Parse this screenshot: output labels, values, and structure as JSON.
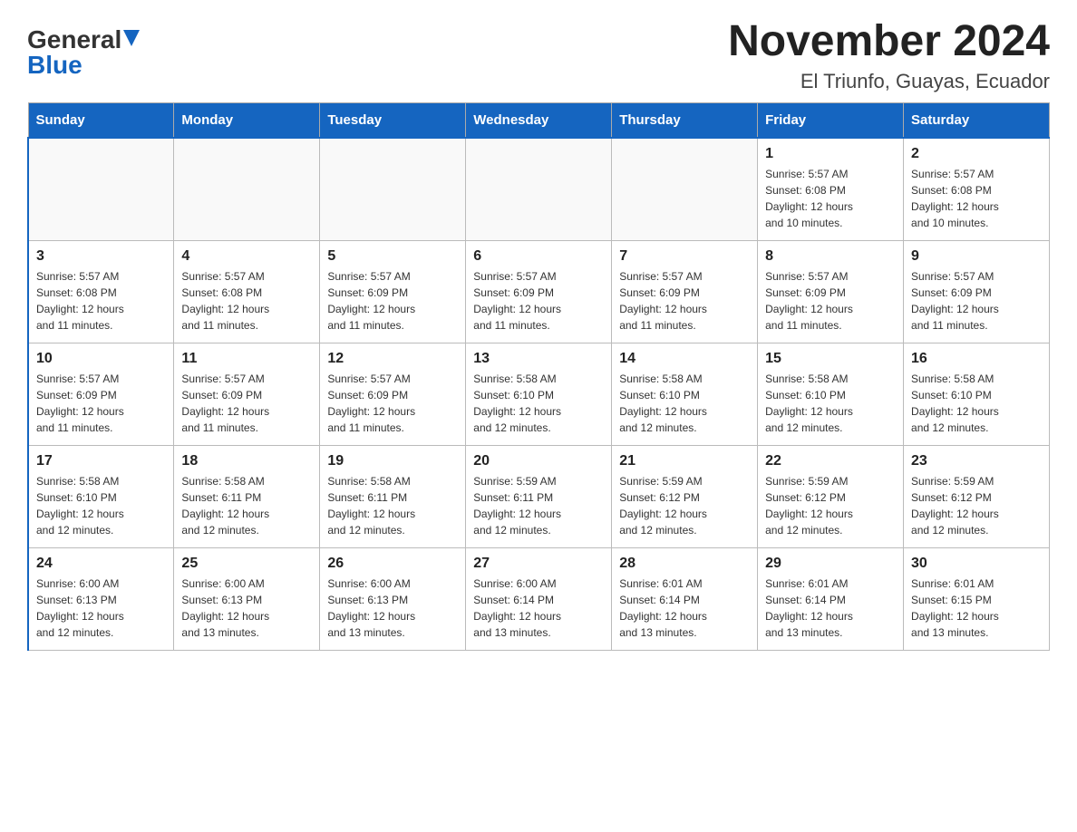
{
  "logo": {
    "general": "General",
    "blue": "Blue",
    "triangle": "▲"
  },
  "header": {
    "month_year": "November 2024",
    "location": "El Triunfo, Guayas, Ecuador"
  },
  "weekdays": [
    "Sunday",
    "Monday",
    "Tuesday",
    "Wednesday",
    "Thursday",
    "Friday",
    "Saturday"
  ],
  "weeks": [
    [
      {
        "day": "",
        "info": ""
      },
      {
        "day": "",
        "info": ""
      },
      {
        "day": "",
        "info": ""
      },
      {
        "day": "",
        "info": ""
      },
      {
        "day": "",
        "info": ""
      },
      {
        "day": "1",
        "info": "Sunrise: 5:57 AM\nSunset: 6:08 PM\nDaylight: 12 hours\nand 10 minutes."
      },
      {
        "day": "2",
        "info": "Sunrise: 5:57 AM\nSunset: 6:08 PM\nDaylight: 12 hours\nand 10 minutes."
      }
    ],
    [
      {
        "day": "3",
        "info": "Sunrise: 5:57 AM\nSunset: 6:08 PM\nDaylight: 12 hours\nand 11 minutes."
      },
      {
        "day": "4",
        "info": "Sunrise: 5:57 AM\nSunset: 6:08 PM\nDaylight: 12 hours\nand 11 minutes."
      },
      {
        "day": "5",
        "info": "Sunrise: 5:57 AM\nSunset: 6:09 PM\nDaylight: 12 hours\nand 11 minutes."
      },
      {
        "day": "6",
        "info": "Sunrise: 5:57 AM\nSunset: 6:09 PM\nDaylight: 12 hours\nand 11 minutes."
      },
      {
        "day": "7",
        "info": "Sunrise: 5:57 AM\nSunset: 6:09 PM\nDaylight: 12 hours\nand 11 minutes."
      },
      {
        "day": "8",
        "info": "Sunrise: 5:57 AM\nSunset: 6:09 PM\nDaylight: 12 hours\nand 11 minutes."
      },
      {
        "day": "9",
        "info": "Sunrise: 5:57 AM\nSunset: 6:09 PM\nDaylight: 12 hours\nand 11 minutes."
      }
    ],
    [
      {
        "day": "10",
        "info": "Sunrise: 5:57 AM\nSunset: 6:09 PM\nDaylight: 12 hours\nand 11 minutes."
      },
      {
        "day": "11",
        "info": "Sunrise: 5:57 AM\nSunset: 6:09 PM\nDaylight: 12 hours\nand 11 minutes."
      },
      {
        "day": "12",
        "info": "Sunrise: 5:57 AM\nSunset: 6:09 PM\nDaylight: 12 hours\nand 11 minutes."
      },
      {
        "day": "13",
        "info": "Sunrise: 5:58 AM\nSunset: 6:10 PM\nDaylight: 12 hours\nand 12 minutes."
      },
      {
        "day": "14",
        "info": "Sunrise: 5:58 AM\nSunset: 6:10 PM\nDaylight: 12 hours\nand 12 minutes."
      },
      {
        "day": "15",
        "info": "Sunrise: 5:58 AM\nSunset: 6:10 PM\nDaylight: 12 hours\nand 12 minutes."
      },
      {
        "day": "16",
        "info": "Sunrise: 5:58 AM\nSunset: 6:10 PM\nDaylight: 12 hours\nand 12 minutes."
      }
    ],
    [
      {
        "day": "17",
        "info": "Sunrise: 5:58 AM\nSunset: 6:10 PM\nDaylight: 12 hours\nand 12 minutes."
      },
      {
        "day": "18",
        "info": "Sunrise: 5:58 AM\nSunset: 6:11 PM\nDaylight: 12 hours\nand 12 minutes."
      },
      {
        "day": "19",
        "info": "Sunrise: 5:58 AM\nSunset: 6:11 PM\nDaylight: 12 hours\nand 12 minutes."
      },
      {
        "day": "20",
        "info": "Sunrise: 5:59 AM\nSunset: 6:11 PM\nDaylight: 12 hours\nand 12 minutes."
      },
      {
        "day": "21",
        "info": "Sunrise: 5:59 AM\nSunset: 6:12 PM\nDaylight: 12 hours\nand 12 minutes."
      },
      {
        "day": "22",
        "info": "Sunrise: 5:59 AM\nSunset: 6:12 PM\nDaylight: 12 hours\nand 12 minutes."
      },
      {
        "day": "23",
        "info": "Sunrise: 5:59 AM\nSunset: 6:12 PM\nDaylight: 12 hours\nand 12 minutes."
      }
    ],
    [
      {
        "day": "24",
        "info": "Sunrise: 6:00 AM\nSunset: 6:13 PM\nDaylight: 12 hours\nand 12 minutes."
      },
      {
        "day": "25",
        "info": "Sunrise: 6:00 AM\nSunset: 6:13 PM\nDaylight: 12 hours\nand 13 minutes."
      },
      {
        "day": "26",
        "info": "Sunrise: 6:00 AM\nSunset: 6:13 PM\nDaylight: 12 hours\nand 13 minutes."
      },
      {
        "day": "27",
        "info": "Sunrise: 6:00 AM\nSunset: 6:14 PM\nDaylight: 12 hours\nand 13 minutes."
      },
      {
        "day": "28",
        "info": "Sunrise: 6:01 AM\nSunset: 6:14 PM\nDaylight: 12 hours\nand 13 minutes."
      },
      {
        "day": "29",
        "info": "Sunrise: 6:01 AM\nSunset: 6:14 PM\nDaylight: 12 hours\nand 13 minutes."
      },
      {
        "day": "30",
        "info": "Sunrise: 6:01 AM\nSunset: 6:15 PM\nDaylight: 12 hours\nand 13 minutes."
      }
    ]
  ]
}
